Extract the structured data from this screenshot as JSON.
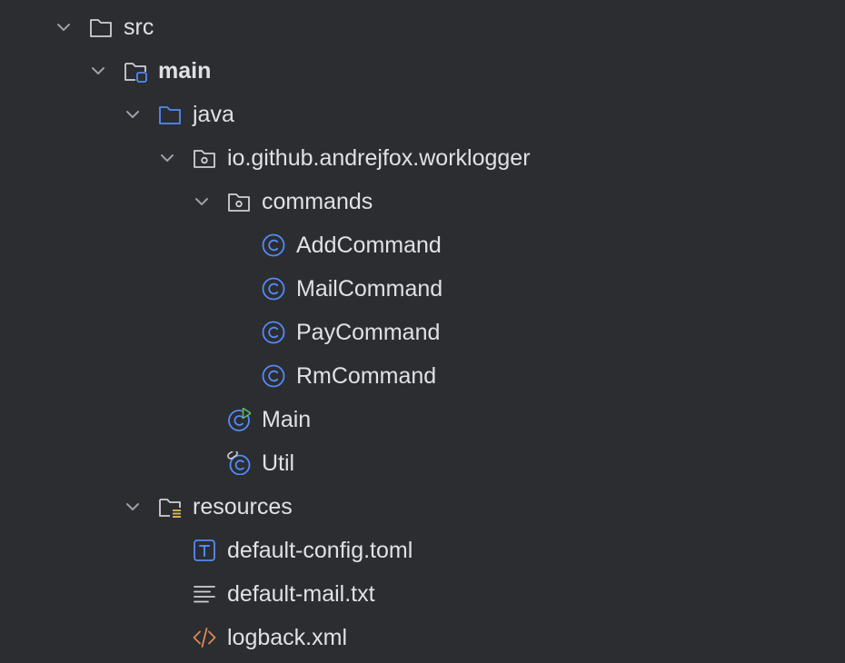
{
  "project_tree": {
    "items": [
      {
        "label": "src",
        "icon": "folder-icon"
      },
      {
        "label": "main",
        "icon": "source-root-folder-icon"
      },
      {
        "label": "java",
        "icon": "sources-folder-icon"
      },
      {
        "label": "io.github.andrejfox.worklogger",
        "icon": "package-icon"
      },
      {
        "label": "commands",
        "icon": "package-icon"
      },
      {
        "label": "AddCommand",
        "icon": "class-icon"
      },
      {
        "label": "MailCommand",
        "icon": "class-icon"
      },
      {
        "label": "PayCommand",
        "icon": "class-icon"
      },
      {
        "label": "RmCommand",
        "icon": "class-icon"
      },
      {
        "label": "Main",
        "icon": "runnable-class-icon"
      },
      {
        "label": "Util",
        "icon": "final-class-icon"
      },
      {
        "label": "resources",
        "icon": "resources-folder-icon"
      },
      {
        "label": "default-config.toml",
        "icon": "toml-file-icon"
      },
      {
        "label": "default-mail.txt",
        "icon": "text-file-icon"
      },
      {
        "label": "logback.xml",
        "icon": "xml-file-icon"
      }
    ]
  },
  "colors": {
    "background": "#2b2d30",
    "text": "#dfe1e5",
    "folder_stroke": "#ced0d6",
    "accent_blue": "#548af7",
    "run_green": "#5fb865",
    "resources_yellow": "#d6ae58",
    "xml_orange": "#e08855"
  }
}
